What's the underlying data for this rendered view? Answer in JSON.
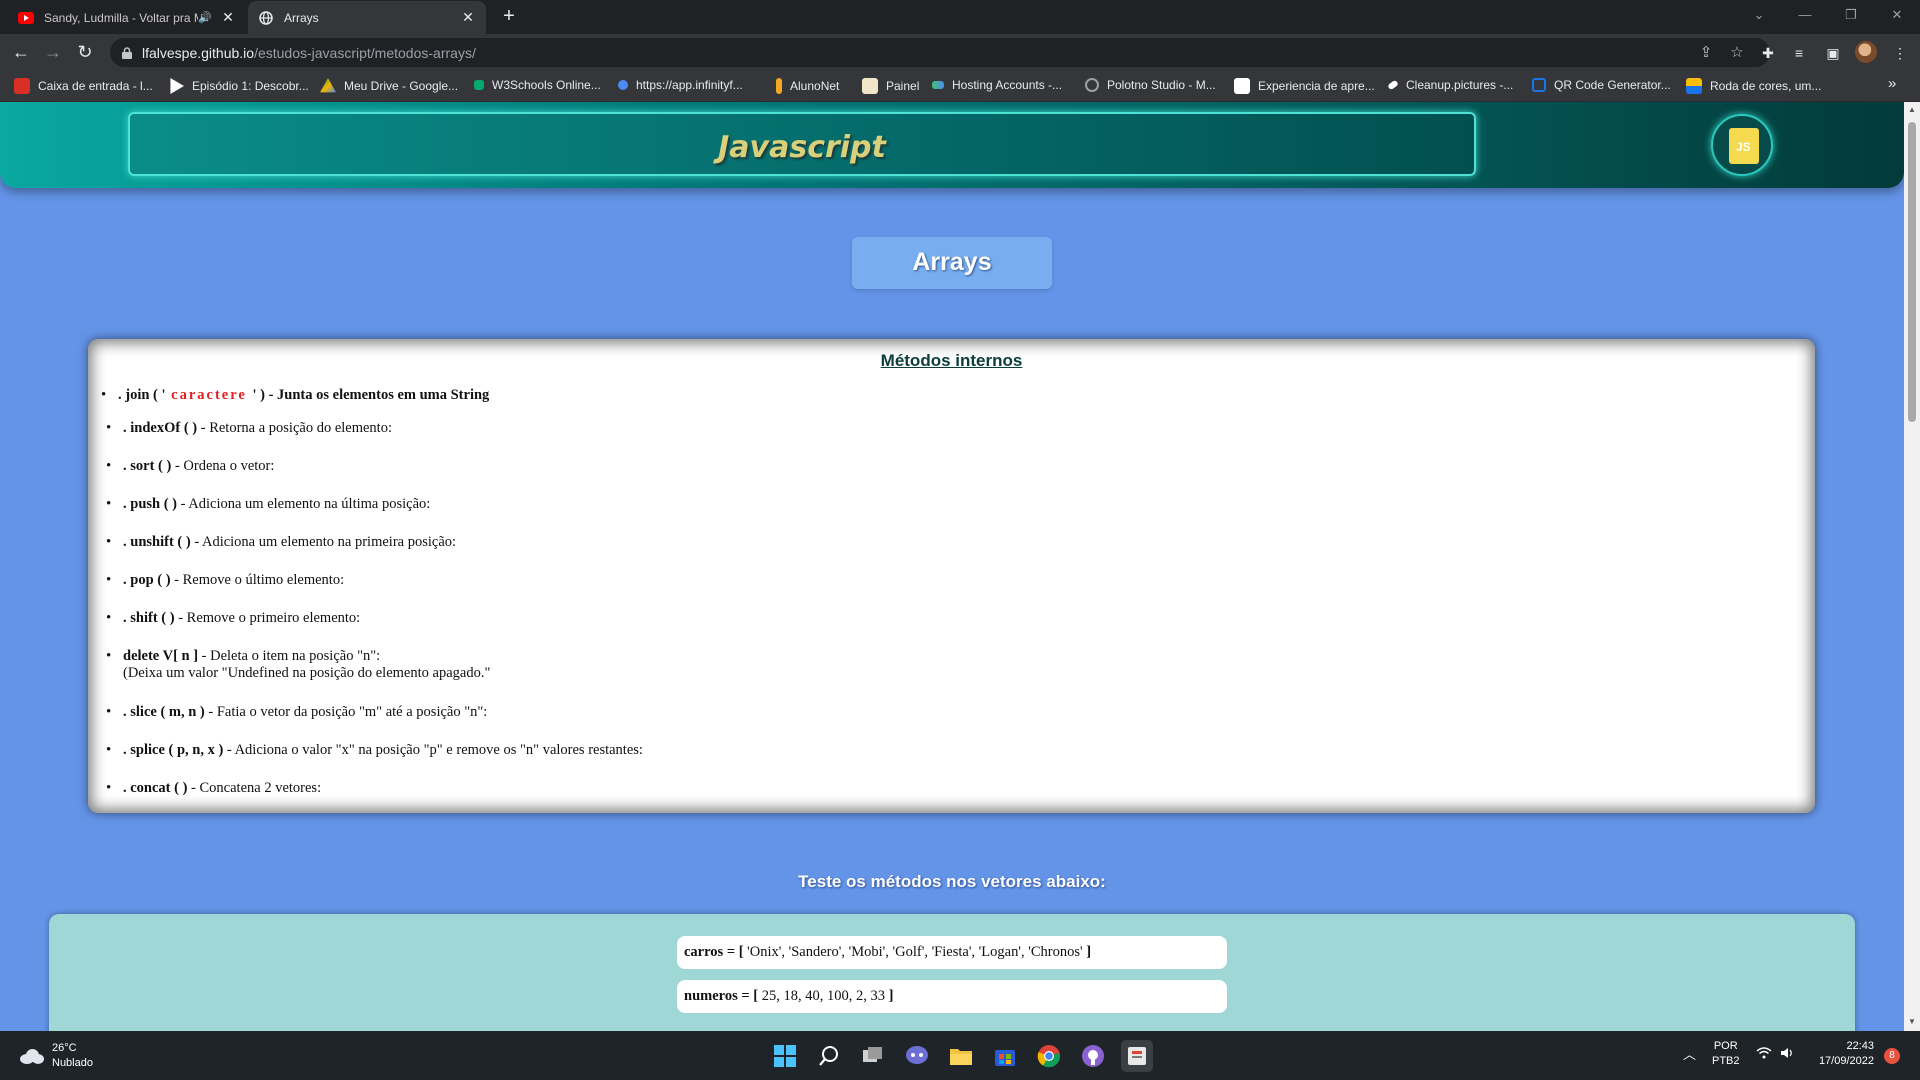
{
  "browser": {
    "tabs": [
      {
        "title": "Sandy, Ludmilla - Voltar pra Mim",
        "favicon": "youtube-icon",
        "audio": true
      },
      {
        "title": "Arrays",
        "favicon": "globe-icon",
        "active": true
      }
    ],
    "url_host": "lfalvespe.github.io",
    "url_path": "/estudos-javascript/metodos-arrays/",
    "bookmarks": [
      {
        "label": "Caixa de entrada - l...",
        "color": "#d93025"
      },
      {
        "label": "Episódio 1: Descobr...",
        "color": "#ffffff"
      },
      {
        "label": "Meu Drive - Google...",
        "color": "#f4b400"
      },
      {
        "label": "W3Schools Online...",
        "color": "#04aa6d"
      },
      {
        "label": "https://app.infinityf...",
        "color": "#4c8bf5"
      },
      {
        "label": "AlunoNet",
        "color": "#f5a623"
      },
      {
        "label": "Painel",
        "color": "#f0e6c8"
      },
      {
        "label": "Hosting Accounts -...",
        "color": "#3cc46a"
      },
      {
        "label": "Polotno Studio - M...",
        "color": "#9aa0a6"
      },
      {
        "label": "Experiencia de apre...",
        "color": "#ffffff"
      },
      {
        "label": "Cleanup.pictures -...",
        "color": "#ffffff"
      },
      {
        "label": "QR Code Generator...",
        "color": "#1a73e8"
      },
      {
        "label": "Roda de cores, um...",
        "color": "#fbbc04"
      }
    ],
    "more_bookmarks": "»"
  },
  "page": {
    "header_title": "Javascript",
    "logo_text": "JS",
    "title": "Arrays",
    "card_title": "Métodos internos",
    "methods": [
      {
        "code": ". join ( '",
        "param": " caractere ",
        "code_end": "' ) -",
        "desc": " Junta os elementos em uma String",
        "desc_bold": true
      },
      {
        "code": ". indexOf ( )",
        "desc": " - Retorna a posição do elemento:"
      },
      {
        "code": ". sort ( )",
        "desc": " - Ordena o vetor:"
      },
      {
        "code": ". push ( )",
        "desc": " - Adiciona um elemento na última posição:"
      },
      {
        "code": ". unshift ( )",
        "desc": " - Adiciona um elemento na primeira posição:"
      },
      {
        "code": ". pop ( )",
        "desc": " - Remove o último elemento:"
      },
      {
        "code": ". shift ( )",
        "desc": " - Remove o primeiro elemento:"
      },
      {
        "code": "delete V[ n ]",
        "desc": " - Deleta o item na posição \"n\":",
        "extra": "(Deixa um valor \"Undefined na posição do elemento apagado.\""
      },
      {
        "code": ". slice ( m, n )",
        "desc": " - Fatia o vetor da posição \"m\" até a posição \"n\":"
      },
      {
        "code": ". splice ( p, n, x )",
        "desc": " - Adiciona o valor \"x\" na posição \"p\" e remove os \"n\" valores restantes:"
      },
      {
        "code": ". concat ( )",
        "desc": " - Concatena 2 vetores:"
      }
    ],
    "test_heading": "Teste os métodos nos vetores abaixo:",
    "vectors": [
      {
        "name": "carros = [",
        "values": " 'Onix', 'Sandero', 'Mobi', 'Golf', 'Fiesta', 'Logan', 'Chronos' ",
        "close": "]"
      },
      {
        "name": "numeros = [",
        "values": " 25, 18, 40, 100, 2, 33 ",
        "close": "]"
      }
    ]
  },
  "taskbar": {
    "temperature": "26°C",
    "weather": "Nublado",
    "lang_top": "POR",
    "lang_bottom": "PTB2",
    "time": "22:43",
    "date": "17/09/2022",
    "notifications": "8",
    "apps": [
      "windows-start-icon",
      "search-icon",
      "task-view-icon",
      "chat-icon",
      "file-explorer-icon",
      "store-icon",
      "chrome-icon",
      "github-icon",
      "app-icon"
    ]
  }
}
